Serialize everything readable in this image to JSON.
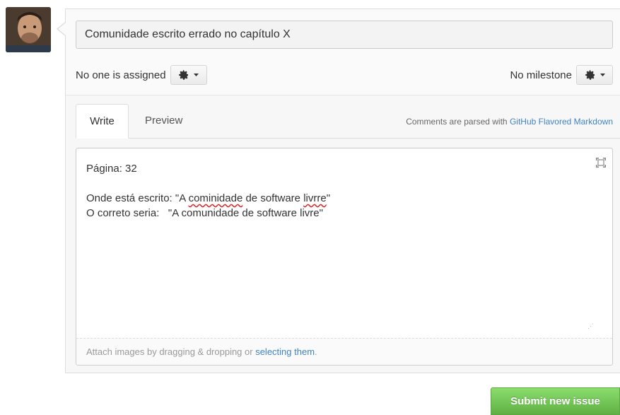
{
  "issue": {
    "title_value": "Comunidade escrito errado no capítulo X"
  },
  "assignee": {
    "label": "No one is assigned",
    "button_icon": "gear-icon"
  },
  "milestone": {
    "label": "No milestone",
    "button_icon": "gear-icon"
  },
  "tabs": [
    {
      "label": "Write",
      "active": true
    },
    {
      "label": "Preview",
      "active": false
    }
  ],
  "markdown_note": {
    "prefix": "Comments are parsed with ",
    "link": "GitHub Flavored Markdown"
  },
  "editor": {
    "line1": "Página: 32",
    "line3_prefix": "Onde está escrito: \"A ",
    "line3_err1": "cominidade",
    "line3_mid": " de software ",
    "line3_err2": "livrre",
    "line3_suffix": "\"",
    "line4": "O correto seria:   \"A comunidade de software livre\""
  },
  "attach": {
    "prefix": "Attach images by dragging & dropping or ",
    "link": "selecting them",
    "suffix": "."
  },
  "submit": {
    "label": "Submit new issue"
  },
  "colors": {
    "link": "#4183c4",
    "submit_green": "#6cc644"
  }
}
